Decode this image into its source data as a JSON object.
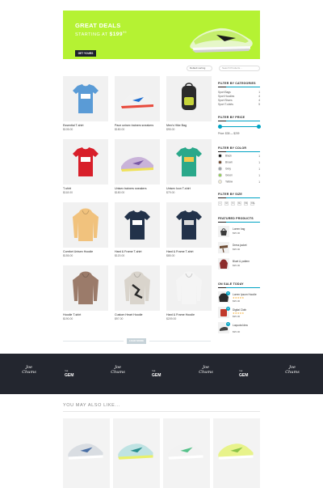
{
  "hero": {
    "title": "GREAT DEALS",
    "subtitle": "STARTING AT",
    "price": "$199",
    "price_cents": "99",
    "button": "GET YOURS"
  },
  "toolbar": {
    "sort_value": "Default sorting",
    "search_placeholder": "Search Products..."
  },
  "products": [
    {
      "name": "Essential T-shirt",
      "price": "$105.00",
      "icon": "tshirt-blue"
    },
    {
      "name": "Pace unisex trainers sneakers",
      "price": "$180.00",
      "icon": "sneaker-colorful"
    },
    {
      "name": "Men's Hike Bag",
      "price": "$95.00",
      "icon": "backpack"
    },
    {
      "name": "T-shirt",
      "price": "$118.00",
      "icon": "tshirt-red"
    },
    {
      "name": "Unisex trainers sneakers",
      "price": "$180.00",
      "icon": "sneaker-purple"
    },
    {
      "name": "Unisex Icon T-shirt",
      "price": "$79.00",
      "icon": "tshirt-green"
    },
    {
      "name": "Comfort Unisex Hoodie",
      "price": "$155.00",
      "icon": "hoodie-yellow"
    },
    {
      "name": "Hard & Frame T-shirt",
      "price": "$120.00",
      "icon": "tshirt-navy"
    },
    {
      "name": "Hard & Frame T-shirt",
      "price": "$85.00",
      "icon": "tshirt-navy-2"
    },
    {
      "name": "Hoodie T-shirt",
      "price": "$190.00",
      "icon": "hoodie-brown"
    },
    {
      "name": "Custom Heart Hoodie",
      "price": "$97.00",
      "icon": "hoodie-pattern"
    },
    {
      "name": "Hard & Frame Hoodie",
      "price": "$209.00",
      "icon": "hoodie-white"
    }
  ],
  "load_more": "LOAD MORE",
  "sidebar": {
    "categories_title": "FILTER BY CATEGORIES",
    "categories": [
      {
        "label": "Sport Bags",
        "count": "1"
      },
      {
        "label": "Sport Hoodies",
        "count": "4"
      },
      {
        "label": "Sport Shoes",
        "count": "4"
      },
      {
        "label": "Sport T-shirts",
        "count": "5"
      }
    ],
    "price_title": "FILTER BY PRICE",
    "price_range": "Price: $38 — $209",
    "price_min_fraction": 0.0,
    "price_max_fraction": 1.0,
    "color_title": "FILTER BY COLOR",
    "colors": [
      {
        "label": "Black",
        "hex": "#111111",
        "count": "1"
      },
      {
        "label": "Brown",
        "hex": "#6b3e1f",
        "count": "1"
      },
      {
        "label": "Gray",
        "hex": "#9aa0a6",
        "count": "1"
      },
      {
        "label": "Green",
        "hex": "#8fd14f",
        "count": "1"
      },
      {
        "label": "Yellow",
        "hex": "#f1ecd5",
        "count": "1"
      }
    ],
    "size_title": "FILTER BY SIZE",
    "sizes": [
      "L",
      "M",
      "S",
      "XL",
      "XS",
      "XXL"
    ],
    "featured_title": "FEATURED PRODUCTS",
    "featured": [
      {
        "name": "Lorem bag",
        "price": "$95.00"
      },
      {
        "name": "Dress jacket",
        "price": "$95.00"
      },
      {
        "name": "Bluet & pattern",
        "price": "$95.00"
      }
    ],
    "sale_title": "ON SALE TODAY",
    "sale": [
      {
        "name": "Lorem Ipsum Hoodie",
        "price": "$95.00",
        "badge": "%",
        "stars": "★★★★★"
      },
      {
        "name": "Digital Cloth",
        "price": "$95.00",
        "badge": "%",
        "stars": "★★★★★"
      },
      {
        "name": "Loquota Idea",
        "price": "$95.00",
        "badge": "%",
        "stars": ""
      }
    ]
  },
  "brands": [
    {
      "kind": "script",
      "line1": "Joe",
      "line2": "Chums"
    },
    {
      "kind": "gem",
      "line1": "GEM",
      "line2": "THE"
    },
    {
      "kind": "script",
      "line1": "Joe",
      "line2": "Chums"
    },
    {
      "kind": "gem",
      "line1": "GEM",
      "line2": "THE"
    },
    {
      "kind": "script",
      "line1": "Joe",
      "line2": "Chums"
    },
    {
      "kind": "gem",
      "line1": "GEM",
      "line2": "THE"
    },
    {
      "kind": "script",
      "line1": "Joe",
      "line2": "Chums"
    }
  ],
  "ymal": {
    "title": "YOU MAY ALSO LIKE...",
    "items": [
      {
        "icon": "sneaker-gray"
      },
      {
        "icon": "sneaker-teal"
      },
      {
        "icon": "sneaker-white-green"
      },
      {
        "icon": "sneaker-lime"
      }
    ]
  },
  "colors": {
    "accent": "#00a3c4",
    "hero_bg": "#b5f233",
    "brand_strip": "#23262f"
  }
}
